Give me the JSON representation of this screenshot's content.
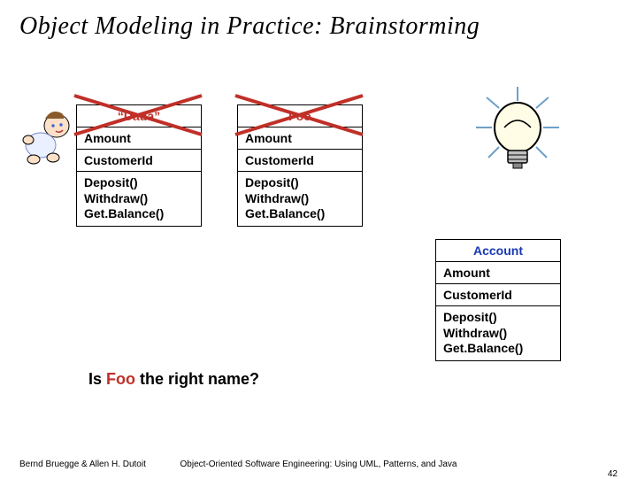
{
  "title": "Object Modeling in Practice:  Brainstorming",
  "classes": {
    "dada": {
      "name": "“Dada”",
      "attr1": "Amount",
      "attr2": "CustomerId",
      "op1": "Deposit()",
      "op2": "Withdraw()",
      "op3": "Get.Balance()"
    },
    "foo": {
      "name": "Foo",
      "attr1": "Amount",
      "attr2": "CustomerId",
      "op1": "Deposit()",
      "op2": "Withdraw()",
      "op3": "Get.Balance()"
    },
    "account": {
      "name": "Account",
      "attr1": "Amount",
      "attr2": "CustomerId",
      "op1": "Deposit()",
      "op2": "Withdraw()",
      "op3": "Get.Balance()"
    }
  },
  "question": {
    "prefix": "Is ",
    "foo": "Foo",
    "suffix": " the right name?"
  },
  "footer": {
    "left": "Bernd Bruegge & Allen H. Dutoit",
    "center": "Object-Oriented Software Engineering: Using UML, Patterns, and Java",
    "right": "42"
  }
}
